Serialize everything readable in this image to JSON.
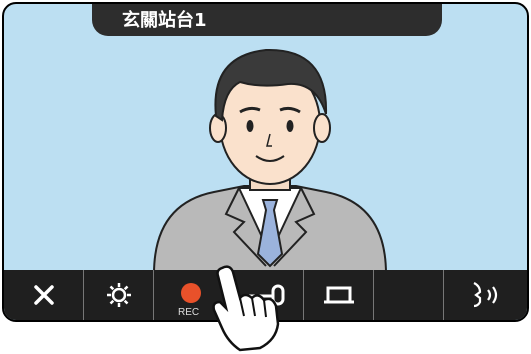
{
  "title": "玄關站台1",
  "toolbar": {
    "buttons": [
      {
        "name": "close",
        "icon": "close-icon"
      },
      {
        "name": "settings",
        "icon": "gear-icon"
      },
      {
        "name": "record",
        "icon": "record-icon",
        "label": "REC"
      },
      {
        "name": "unlock",
        "icon": "key-icon"
      },
      {
        "name": "option",
        "icon": "switch-icon"
      },
      {
        "name": "blank",
        "icon": ""
      },
      {
        "name": "talk",
        "icon": "speaker-talk-icon"
      }
    ]
  },
  "colors": {
    "screen_bg": "#bcdff2",
    "toolbar_bg": "#1f1f1f",
    "record": "#e8512a"
  }
}
